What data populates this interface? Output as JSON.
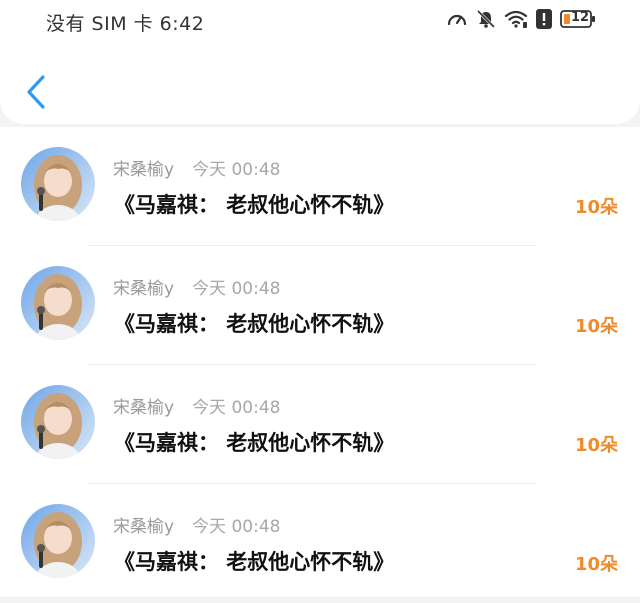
{
  "status_bar": {
    "carrier_time": "没有 SIM 卡 6:42",
    "battery_level": "12",
    "icons": [
      "speed-icon",
      "mute-bell-icon",
      "wifi-icon",
      "alert-icon",
      "battery-icon"
    ]
  },
  "header": {
    "back_icon": "chevron-left-icon",
    "accent_color": "#2a9bf0"
  },
  "items": [
    {
      "user": "宋桑榆y",
      "time": "今天 00:48",
      "title": "《马嘉祺：  老叔他心怀不轨》",
      "count": "10朵"
    },
    {
      "user": "宋桑榆y",
      "time": "今天 00:48",
      "title": "《马嘉祺：  老叔他心怀不轨》",
      "count": "10朵"
    },
    {
      "user": "宋桑榆y",
      "time": "今天 00:48",
      "title": "《马嘉祺：  老叔他心怀不轨》",
      "count": "10朵"
    },
    {
      "user": "宋桑榆y",
      "time": "今天 00:48",
      "title": "《马嘉祺：  老叔他心怀不轨》",
      "count": "10朵"
    }
  ],
  "colors": {
    "count": "#f08b2c",
    "title": "#111111",
    "meta": "#9a9a9a"
  }
}
